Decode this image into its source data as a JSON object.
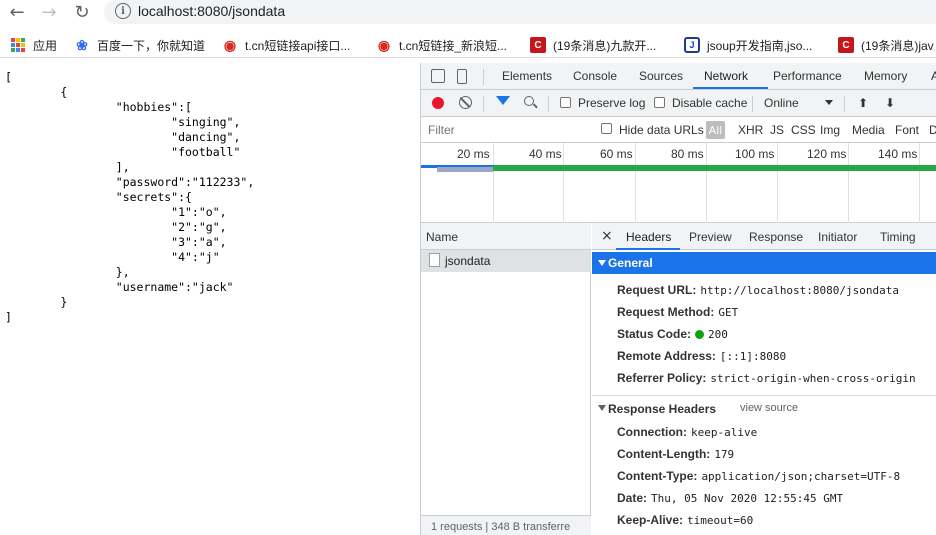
{
  "browser": {
    "url": "localhost:8080/jsondata",
    "bookmarks": [
      {
        "label": "应用",
        "icon": "apps-grid-icon"
      },
      {
        "label": "百度一下，你就知道",
        "icon": "baidu-paw-icon"
      },
      {
        "label": "t.cn短链接api接口...",
        "icon": "weibo-icon"
      },
      {
        "label": "t.cn短链接_新浪短...",
        "icon": "weibo-icon"
      },
      {
        "label": "(19条消息)九款开...",
        "icon": "csdn-icon"
      },
      {
        "label": "jsoup开发指南,jso...",
        "icon": "jsoup-icon"
      },
      {
        "label": "(19条消息)jav",
        "icon": "csdn-icon"
      }
    ]
  },
  "page": {
    "json_lines": [
      "[",
      "        {",
      "                \"hobbies\":[",
      "                        \"singing\",",
      "                        \"dancing\",",
      "                        \"football\"",
      "                ],",
      "                \"password\":\"112233\",",
      "                \"secrets\":{",
      "                        \"1\":\"o\",",
      "                        \"2\":\"g\",",
      "                        \"3\":\"a\",",
      "                        \"4\":\"j\"",
      "                },",
      "                \"username\":\"jack\"",
      "        }",
      "]"
    ]
  },
  "devtools": {
    "tabs": [
      "Elements",
      "Console",
      "Sources",
      "Network",
      "Performance",
      "Memory",
      "A"
    ],
    "active_tab": "Network",
    "network_toolbar": {
      "preserve_log": "Preserve log",
      "disable_cache": "Disable cache",
      "throttle": "Online"
    },
    "filter": {
      "placeholder": "Filter",
      "hide_data_urls": "Hide data URLs",
      "types": [
        "All",
        "XHR",
        "JS",
        "CSS",
        "Img",
        "Media",
        "Font",
        "D"
      ]
    },
    "timeline_ticks": [
      "20 ms",
      "40 ms",
      "60 ms",
      "80 ms",
      "100 ms",
      "120 ms",
      "140 ms"
    ],
    "requests": {
      "column": "Name",
      "rows": [
        "jsondata"
      ],
      "status_text": "1 requests  |  348 B transferre"
    },
    "headers_pane": {
      "close": "×",
      "tabs": [
        "Headers",
        "Preview",
        "Response",
        "Initiator",
        "Timing"
      ],
      "general_title": "General",
      "general": [
        {
          "k": "Request URL:",
          "v": "http://localhost:8080/jsondata"
        },
        {
          "k": "Request Method:",
          "v": "GET"
        },
        {
          "k": "Status Code:",
          "v": "200"
        },
        {
          "k": "Remote Address:",
          "v": "[::1]:8080"
        },
        {
          "k": "Referrer Policy:",
          "v": "strict-origin-when-cross-origin"
        }
      ],
      "response_title": "Response Headers",
      "view_source": "view source",
      "response": [
        {
          "k": "Connection:",
          "v": "keep-alive"
        },
        {
          "k": "Content-Length:",
          "v": "179"
        },
        {
          "k": "Content-Type:",
          "v": "application/json;charset=UTF-8"
        },
        {
          "k": "Date:",
          "v": "Thu, 05 Nov 2020 12:55:45 GMT"
        },
        {
          "k": "Keep-Alive:",
          "v": "timeout=60"
        }
      ]
    },
    "colors": {
      "accent": "#1a73e8",
      "record": "#e8182c",
      "status_ok": "#0ca40c"
    }
  }
}
